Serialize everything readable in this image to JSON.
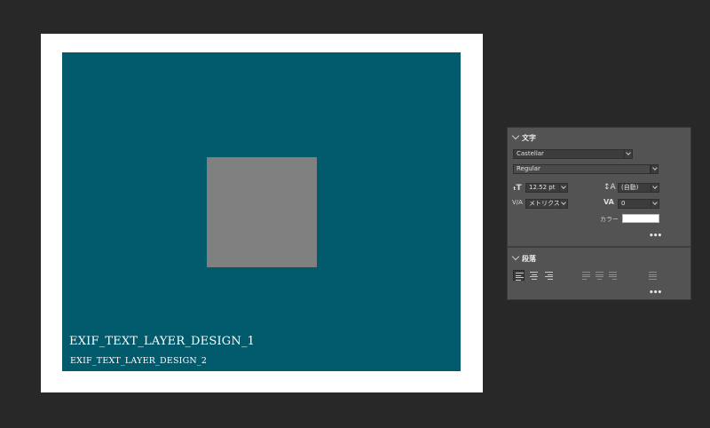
{
  "canvas": {
    "text_layer_1": "EXIF_TEXT_LAYER_DESIGN_1",
    "text_layer_2": "EXIF_TEXT_LAYER_DESIGN_2",
    "colors": {
      "background": "#282828",
      "border": "#ffffff",
      "fill": "#025a6d",
      "square": "#808080"
    }
  },
  "character_panel": {
    "title": "文字",
    "font_family": "Castellar",
    "font_style": "Regular",
    "font_size": "12.52 pt",
    "leading": "(自動)",
    "kerning": "メトリクス",
    "tracking": "0",
    "color_label": "カラー",
    "color_value": "#ffffff",
    "more": "•••"
  },
  "paragraph_panel": {
    "title": "段落",
    "more": "•••"
  }
}
